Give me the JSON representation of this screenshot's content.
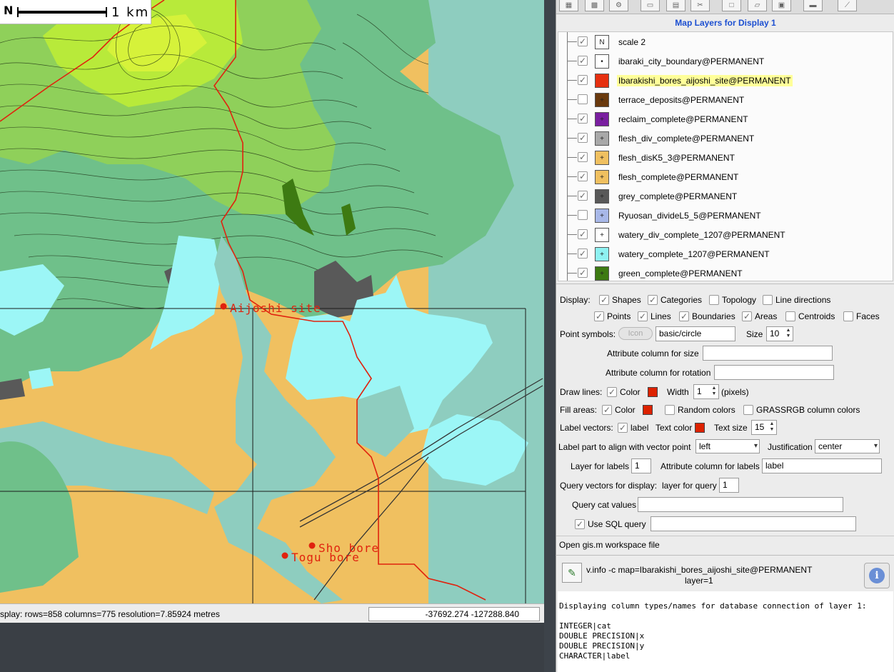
{
  "map": {
    "scale_north": "N",
    "scale_label": "1   km",
    "status_text": "splay: rows=858  columns=775  resolution=7.85924 metres",
    "coordinates": "-37692.274   -127288.840",
    "point_labels": [
      {
        "name": "Aijoshi",
        "text": "Aijoshi site"
      },
      {
        "name": "Sho",
        "text": "Sho bore"
      },
      {
        "name": "Togu",
        "text": "Togu bore"
      }
    ]
  },
  "layers_panel": {
    "title": "Map Layers for Display 1",
    "toolbar_icons": [
      "add-raster-icon",
      "add-rgb-icon",
      "add-vector-icon",
      "add-group-icon",
      "add-text-icon",
      "delete-icon",
      "new-workspace-icon",
      "open-icon",
      "save-icon",
      "print-icon",
      "settings-icon"
    ],
    "layers": [
      {
        "name": "scale 2",
        "checked": true,
        "icon": "scale-icon",
        "color": "#ffffff",
        "glyph": "N"
      },
      {
        "name": "ibaraki_city_boundary@PERMANENT",
        "checked": true,
        "icon": "vector-boundary-icon",
        "color": "#ffffff",
        "glyph": "•"
      },
      {
        "name": "Ibarakishi_bores_aijoshi_site@PERMANENT",
        "checked": true,
        "icon": "vector-point-icon",
        "color": "#e63010",
        "glyph": "",
        "selected": true
      },
      {
        "name": "terrace_deposits@PERMANENT",
        "checked": false,
        "icon": "vector-area-icon",
        "color": "#6a3a0e",
        "glyph": "+"
      },
      {
        "name": "reclaim_complete@PERMANENT",
        "checked": true,
        "icon": "vector-area-icon",
        "color": "#7a1fa0",
        "glyph": "+"
      },
      {
        "name": "flesh_div_complete@PERMANENT",
        "checked": true,
        "icon": "vector-area-icon",
        "color": "#a8a8a8",
        "glyph": "+"
      },
      {
        "name": "flesh_disK5_3@PERMANENT",
        "checked": true,
        "icon": "vector-area-icon",
        "color": "#f0c060",
        "glyph": "+"
      },
      {
        "name": "flesh_complete@PERMANENT",
        "checked": true,
        "icon": "vector-area-icon",
        "color": "#f0c060",
        "glyph": "+"
      },
      {
        "name": "grey_complete@PERMANENT",
        "checked": true,
        "icon": "vector-area-icon",
        "color": "#595959",
        "glyph": "+"
      },
      {
        "name": "Ryuosan_divideL5_5@PERMANENT",
        "checked": false,
        "icon": "vector-area-icon",
        "color": "#a8b8e8",
        "glyph": "+"
      },
      {
        "name": "watery_div_complete_1207@PERMANENT",
        "checked": true,
        "icon": "vector-area-icon",
        "color": "#ffffff",
        "glyph": "+"
      },
      {
        "name": "watery_complete_1207@PERMANENT",
        "checked": true,
        "icon": "vector-area-icon",
        "color": "#8ef2f2",
        "glyph": "+"
      },
      {
        "name": "green_complete@PERMANENT",
        "checked": true,
        "icon": "vector-area-icon",
        "color": "#3d7a12",
        "glyph": "+"
      }
    ]
  },
  "properties": {
    "display_label": "Display:",
    "shapes": "Shapes",
    "categories": "Categories",
    "topology": "Topology",
    "line_directions": "Line directions",
    "points": "Points",
    "lines": "Lines",
    "boundaries": "Boundaries",
    "areas": "Areas",
    "centroids": "Centroids",
    "faces": "Faces",
    "point_symbols_label": "Point symbols:",
    "icon_button": "Icon",
    "symbol_value": "basic/circle",
    "size_label": "Size",
    "size_value": "10",
    "attr_size_label": "Attribute column for size",
    "attr_size_value": "",
    "attr_rotation_label": "Attribute column for rotation",
    "attr_rotation_value": "",
    "draw_lines_label": "Draw lines:",
    "color_label": "Color",
    "width_label": "Width",
    "width_value": "1",
    "pixels_label": "(pixels)",
    "fill_areas_label": "Fill areas:",
    "random_colors": "Random colors",
    "grassrgb_colors": "GRASSRGB column colors",
    "label_vectors_label": "Label vectors:",
    "label_check": "label",
    "text_color_label": "Text color",
    "text_size_label": "Text size",
    "text_size_value": "15",
    "label_align_label": "Label part to align with vector point",
    "label_align_value": "left",
    "justification_label": "Justification",
    "justification_value": "center",
    "layer_for_labels_label": "Layer for labels",
    "layer_for_labels_value": "1",
    "attr_labels_label": "Attribute column for labels",
    "attr_labels_value": "label",
    "query_vectors_label": "Query vectors for display:",
    "layer_for_query_label": "layer for query",
    "layer_for_query_value": "1",
    "query_cat_label": "Query cat values",
    "query_cat_value": "",
    "use_sql_label": "Use SQL query",
    "sql_value": "",
    "workspace_label": "Open gis.m workspace file",
    "line_color": "#dd2200",
    "fill_color": "#dd2200",
    "text_color": "#dd2200"
  },
  "console": {
    "command": "v.info -c map=Ibarakishi_bores_aijoshi_site@PERMANENT",
    "command_cont": "layer=1",
    "output_lines": [
      "",
      "Displaying column types/names for database connection of layer 1:",
      "",
      "INTEGER|cat",
      "DOUBLE PRECISION|x",
      "DOUBLE PRECISION|y",
      "CHARACTER|label"
    ]
  }
}
